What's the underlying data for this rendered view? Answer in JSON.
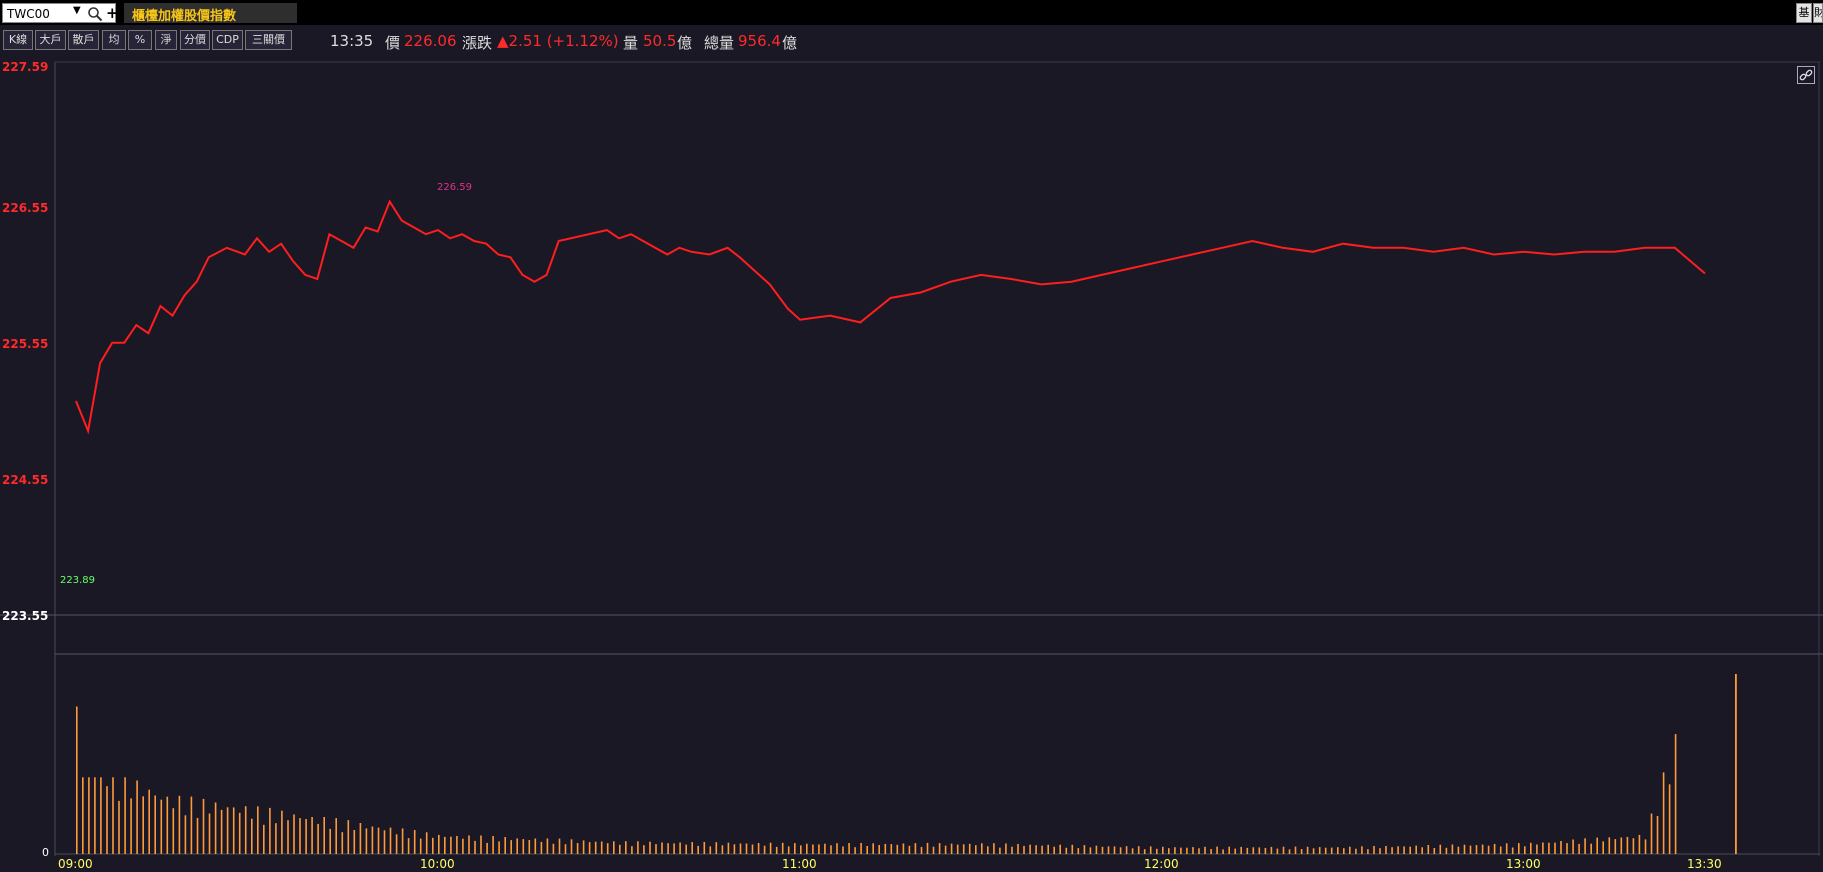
{
  "header": {
    "symbol": "TWC00",
    "index_name": "櫃檯加權股價指數",
    "right_buttons": [
      "基",
      "財"
    ]
  },
  "toolbar": {
    "buttons": [
      "K線",
      "大戶",
      "散戶",
      "均",
      "%",
      "淨",
      "分價",
      "CDP",
      "三關價"
    ],
    "time": "13:35",
    "price_label": "價",
    "price_value": "226.06",
    "change_label": "漲跌",
    "change_value": "▲2.51 (+1.12%)",
    "volume_label": "量",
    "volume_value": "50.5",
    "volume_unit": "億",
    "total_volume_label": "總量",
    "total_volume_value": "956.4",
    "total_volume_unit": "億"
  },
  "colors": {
    "background": "#1a1825",
    "price_line": "#ff1e1e",
    "volume_bar": "#ff9a3c",
    "axis_price": "#ff2a2a",
    "axis_time": "#ffff66",
    "high_label": "#e0308a",
    "low_label": "#66ff66"
  },
  "chart_data": {
    "type": "line",
    "y_ticks": [
      "227.59",
      "226.55",
      "225.55",
      "224.55",
      "223.55"
    ],
    "ylim": [
      223.55,
      227.59
    ],
    "x_ticks": [
      "09:00",
      "10:00",
      "11:00",
      "12:00",
      "13:00",
      "13:30"
    ],
    "high_label": "226.59",
    "low_label": "223.89",
    "volume_zero_label": "0",
    "price_series": {
      "x": [
        "09:00",
        "09:02",
        "09:04",
        "09:06",
        "09:08",
        "09:10",
        "09:12",
        "09:14",
        "09:16",
        "09:18",
        "09:20",
        "09:22",
        "09:25",
        "09:28",
        "09:30",
        "09:32",
        "09:34",
        "09:36",
        "09:38",
        "09:40",
        "09:42",
        "09:44",
        "09:46",
        "09:48",
        "09:50",
        "09:52",
        "09:54",
        "09:56",
        "09:58",
        "10:00",
        "10:02",
        "10:04",
        "10:06",
        "10:08",
        "10:10",
        "10:12",
        "10:14",
        "10:16",
        "10:18",
        "10:20",
        "10:25",
        "10:28",
        "10:30",
        "10:32",
        "10:34",
        "10:36",
        "10:38",
        "10:40",
        "10:42",
        "10:45",
        "10:48",
        "10:50",
        "10:52",
        "10:55",
        "10:58",
        "11:00",
        "11:05",
        "11:10",
        "11:15",
        "11:20",
        "11:25",
        "11:30",
        "11:35",
        "11:40",
        "11:45",
        "11:50",
        "11:55",
        "12:00",
        "12:05",
        "12:10",
        "12:15",
        "12:20",
        "12:25",
        "12:30",
        "12:35",
        "12:40",
        "12:45",
        "12:50",
        "12:55",
        "13:00",
        "13:05",
        "13:10",
        "13:15",
        "13:20",
        "13:25",
        "13:30"
      ],
      "values": [
        225.12,
        224.9,
        225.4,
        225.55,
        225.55,
        225.68,
        225.62,
        225.82,
        225.75,
        225.9,
        226.0,
        226.18,
        226.25,
        226.2,
        226.32,
        226.22,
        226.28,
        226.15,
        226.05,
        226.02,
        226.35,
        226.3,
        226.25,
        226.4,
        226.37,
        226.59,
        226.45,
        226.4,
        226.35,
        226.38,
        226.32,
        226.35,
        226.3,
        226.28,
        226.2,
        226.18,
        226.05,
        226.0,
        226.05,
        226.3,
        226.35,
        226.38,
        226.32,
        226.35,
        226.3,
        226.25,
        226.2,
        226.25,
        226.22,
        226.2,
        226.25,
        226.18,
        226.1,
        225.98,
        225.8,
        225.72,
        225.75,
        225.7,
        225.88,
        225.92,
        226.0,
        226.05,
        226.02,
        225.98,
        226.0,
        226.05,
        226.1,
        226.15,
        226.2,
        226.25,
        226.3,
        226.25,
        226.22,
        226.28,
        226.25,
        226.25,
        226.22,
        226.25,
        226.2,
        226.22,
        226.2,
        226.22,
        226.22,
        226.25,
        226.25,
        226.06
      ]
    },
    "volume_series": {
      "x": [
        "09:00",
        "09:05",
        "09:10",
        "09:15",
        "09:30",
        "10:00",
        "10:30",
        "11:00",
        "11:30",
        "12:00",
        "12:30",
        "13:00",
        "13:20",
        "13:30"
      ],
      "values": [
        100,
        52,
        41,
        33,
        26,
        11,
        7,
        6,
        6,
        4,
        4,
        6,
        11,
        122
      ]
    }
  }
}
